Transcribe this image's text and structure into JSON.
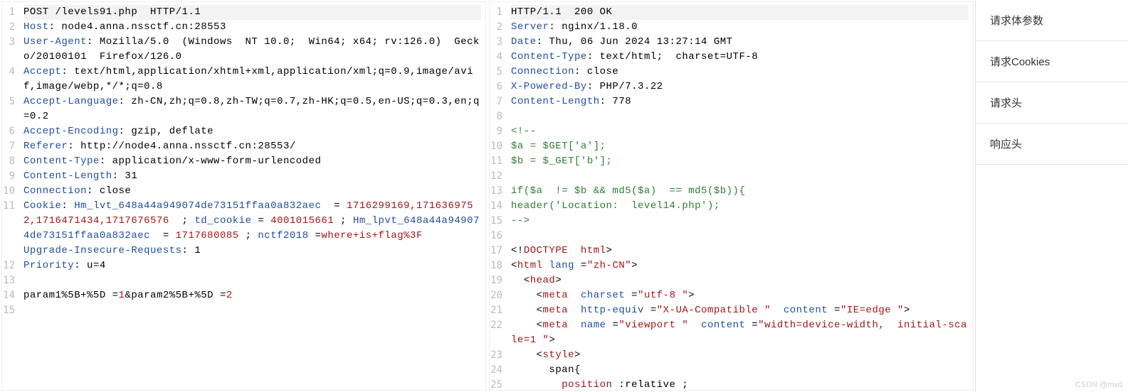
{
  "request": {
    "lines": [
      [
        {
          "c": "",
          "t": "POST /levels91.php  HTTP/1.1"
        }
      ],
      [
        {
          "c": "hdr",
          "t": "Host"
        },
        {
          "c": "",
          "t": ": node4.anna.nssctf.cn:28553"
        }
      ],
      [
        {
          "c": "hdr",
          "t": "User-Agent"
        },
        {
          "c": "",
          "t": ": Mozilla/5.0  (Windows  NT 10.0;  Win64; x64; rv:126.0)  Gecko/20100101  Firefox/126.0"
        }
      ],
      [
        {
          "c": "hdr",
          "t": "Accept"
        },
        {
          "c": "",
          "t": ": text/html,application/xhtml+xml,application/xml;q=0.9,image/avif,image/webp,*/*;q=0.8"
        }
      ],
      [
        {
          "c": "hdr",
          "t": "Accept-Language"
        },
        {
          "c": "",
          "t": ": zh-CN,zh;q=0.8,zh-TW;q=0.7,zh-HK;q=0.5,en-US;q=0.3,en;q=0.2"
        }
      ],
      [
        {
          "c": "hdr",
          "t": "Accept-Encoding"
        },
        {
          "c": "",
          "t": ": gzip, deflate"
        }
      ],
      [
        {
          "c": "hdr",
          "t": "Referer"
        },
        {
          "c": "",
          "t": ": http://node4.anna.nssctf.cn:28553/"
        }
      ],
      [
        {
          "c": "hdr",
          "t": "Content-Type"
        },
        {
          "c": "",
          "t": ": application/x-www-form-urlencoded"
        }
      ],
      [
        {
          "c": "hdr",
          "t": "Content-Length"
        },
        {
          "c": "",
          "t": ": 31"
        }
      ],
      [
        {
          "c": "hdr",
          "t": "Connection"
        },
        {
          "c": "",
          "t": ": close"
        }
      ],
      [
        {
          "c": "hdr",
          "t": "Cookie"
        },
        {
          "c": "",
          "t": ": "
        },
        {
          "c": "hdr",
          "t": "Hm_lvt_648a44a949074de73151ffaa0a832aec "
        },
        {
          "c": "",
          "t": " = "
        },
        {
          "c": "cookie-val",
          "t": "1716299169,1716369752,1716471434,1717676576 "
        },
        {
          "c": "",
          "t": " ; "
        },
        {
          "c": "hdr",
          "t": "td_cookie"
        },
        {
          "c": "",
          "t": " = "
        },
        {
          "c": "cookie-val",
          "t": "4001015661"
        },
        {
          "c": "",
          "t": " ; "
        },
        {
          "c": "hdr",
          "t": "Hm_lpvt_648a44a949074de73151ffaa0a832aec "
        },
        {
          "c": "",
          "t": " = "
        },
        {
          "c": "cookie-val",
          "t": "1717680085"
        },
        {
          "c": "",
          "t": " ; "
        },
        {
          "c": "hdr",
          "t": "nctf2018"
        },
        {
          "c": "",
          "t": " ="
        },
        {
          "c": "cookie-val",
          "t": "where+is+flag%3F"
        }
      ],
      [
        {
          "c": "hdr",
          "t": "Upgrade-Insecure-Requests"
        },
        {
          "c": "",
          "t": ": 1"
        }
      ],
      [
        {
          "c": "hdr",
          "t": "Priority"
        },
        {
          "c": "",
          "t": ": u=4"
        }
      ],
      [
        {
          "c": "",
          "t": ""
        }
      ],
      [
        {
          "c": "param",
          "t": "param1%5B+%5D"
        },
        {
          "c": "",
          "t": " ="
        },
        {
          "c": "pval",
          "t": "1"
        },
        {
          "c": "",
          "t": "&"
        },
        {
          "c": "param",
          "t": "param2%5B+%5D"
        },
        {
          "c": "",
          "t": " ="
        },
        {
          "c": "pval",
          "t": "2"
        }
      ]
    ],
    "line_numbers": [
      "1",
      "2",
      "3",
      "4",
      "5",
      "6",
      "7",
      "8",
      "9",
      "10",
      "11",
      "12",
      "13",
      "14",
      "15"
    ],
    "wrap_heights": [
      1,
      1,
      2,
      2,
      2,
      1,
      1,
      1,
      1,
      1,
      4,
      1,
      1,
      1,
      1
    ]
  },
  "response": {
    "lines": [
      [
        {
          "c": "",
          "t": "HTTP/1.1  200 OK"
        }
      ],
      [
        {
          "c": "hdr",
          "t": "Server"
        },
        {
          "c": "",
          "t": ": nginx/1.18.0"
        }
      ],
      [
        {
          "c": "hdr",
          "t": "Date"
        },
        {
          "c": "",
          "t": ": Thu, 06 Jun 2024 13:27:14 GMT"
        }
      ],
      [
        {
          "c": "hdr",
          "t": "Content-Type"
        },
        {
          "c": "",
          "t": ": text/html;  charset=UTF-8"
        }
      ],
      [
        {
          "c": "hdr",
          "t": "Connection"
        },
        {
          "c": "",
          "t": ": close"
        }
      ],
      [
        {
          "c": "hdr",
          "t": "X-Powered-By"
        },
        {
          "c": "",
          "t": ": PHP/7.3.22"
        }
      ],
      [
        {
          "c": "hdr",
          "t": "Content-Length"
        },
        {
          "c": "",
          "t": ": 778"
        }
      ],
      [
        {
          "c": "",
          "t": ""
        }
      ],
      [
        {
          "c": "comment",
          "t": "<!--"
        }
      ],
      [
        {
          "c": "comment",
          "t": "$a = $GET['a'];"
        }
      ],
      [
        {
          "c": "comment",
          "t": "$b = $_GET['b'];"
        }
      ],
      [
        {
          "c": "",
          "t": ""
        }
      ],
      [
        {
          "c": "comment",
          "t": "if($a  != $b && md5($a)  == md5($b)){"
        }
      ],
      [
        {
          "c": "comment",
          "t": "header('Location:  level14.php');"
        }
      ],
      [
        {
          "c": "comment",
          "t": "-->"
        }
      ],
      [
        {
          "c": "",
          "t": ""
        }
      ],
      [
        {
          "c": "",
          "t": "<!"
        },
        {
          "c": "tag",
          "t": "DOCTYPE  html"
        },
        {
          "c": "",
          "t": ">"
        }
      ],
      [
        {
          "c": "",
          "t": "<"
        },
        {
          "c": "tag",
          "t": "html"
        },
        {
          "c": "",
          "t": " "
        },
        {
          "c": "attr",
          "t": "lang"
        },
        {
          "c": "",
          "t": " ="
        },
        {
          "c": "aval",
          "t": "\"zh-CN\""
        },
        {
          "c": "",
          "t": ">"
        }
      ],
      [
        {
          "c": "",
          "t": "  <"
        },
        {
          "c": "tag",
          "t": "head"
        },
        {
          "c": "",
          "t": ">"
        }
      ],
      [
        {
          "c": "",
          "t": "    <"
        },
        {
          "c": "tag",
          "t": "meta"
        },
        {
          "c": "",
          "t": "  "
        },
        {
          "c": "attr",
          "t": "charset"
        },
        {
          "c": "",
          "t": " ="
        },
        {
          "c": "aval",
          "t": "\"utf-8 \""
        },
        {
          "c": "",
          "t": ">"
        }
      ],
      [
        {
          "c": "",
          "t": "    <"
        },
        {
          "c": "tag",
          "t": "meta"
        },
        {
          "c": "",
          "t": "  "
        },
        {
          "c": "attr",
          "t": "http-equiv"
        },
        {
          "c": "",
          "t": " ="
        },
        {
          "c": "aval",
          "t": "\"X-UA-Compatible \""
        },
        {
          "c": "",
          "t": "  "
        },
        {
          "c": "attr",
          "t": "content"
        },
        {
          "c": "",
          "t": " ="
        },
        {
          "c": "aval",
          "t": "\"IE=edge \""
        },
        {
          "c": "",
          "t": ">"
        }
      ],
      [
        {
          "c": "",
          "t": "    <"
        },
        {
          "c": "tag",
          "t": "meta"
        },
        {
          "c": "",
          "t": "  "
        },
        {
          "c": "attr",
          "t": "name"
        },
        {
          "c": "",
          "t": " ="
        },
        {
          "c": "aval",
          "t": "\"viewport \""
        },
        {
          "c": "",
          "t": "  "
        },
        {
          "c": "attr",
          "t": "content"
        },
        {
          "c": "",
          "t": " ="
        },
        {
          "c": "aval",
          "t": "\"width=device-width,  initial-scale=1 \""
        },
        {
          "c": "",
          "t": ">"
        }
      ],
      [
        {
          "c": "",
          "t": "    <"
        },
        {
          "c": "tag",
          "t": "style"
        },
        {
          "c": "",
          "t": ">"
        }
      ],
      [
        {
          "c": "",
          "t": "      span{"
        }
      ],
      [
        {
          "c": "",
          "t": "        "
        },
        {
          "c": "tag",
          "t": "position"
        },
        {
          "c": "",
          "t": " :relative ;"
        }
      ]
    ],
    "line_numbers": [
      "1",
      "2",
      "3",
      "4",
      "5",
      "6",
      "7",
      "8",
      "9",
      "10",
      "11",
      "12",
      "13",
      "14",
      "15",
      "16",
      "17",
      "18",
      "19",
      "20",
      "21",
      "22",
      "23",
      "24",
      "25"
    ],
    "wrap_heights": [
      1,
      1,
      1,
      1,
      1,
      1,
      1,
      1,
      1,
      1,
      1,
      1,
      1,
      1,
      1,
      1,
      1,
      1,
      1,
      1,
      1,
      2,
      1,
      1,
      1
    ]
  },
  "sidebar": {
    "items": [
      "请求体参数",
      "请求Cookies",
      "请求头",
      "响应头"
    ]
  },
  "watermark": "CSDN @mxd"
}
